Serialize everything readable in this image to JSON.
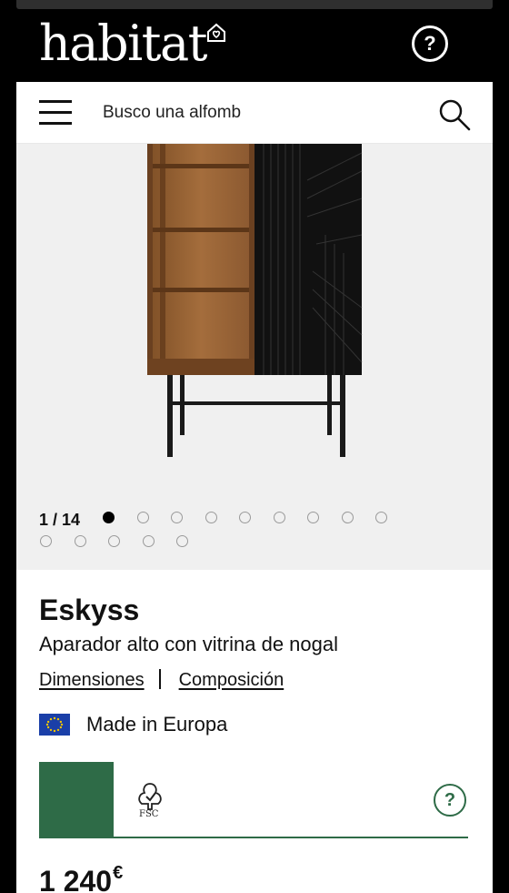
{
  "header": {
    "logo_text": "habitat",
    "help_label": "?"
  },
  "search": {
    "value": "Busco una alfomb"
  },
  "gallery": {
    "counter": "1 / 14",
    "total_images": 14,
    "current_image": 1
  },
  "product": {
    "name": "Eskyss",
    "description": "Aparador alto con vitrina de nogal",
    "link_dimensions": "Dimensiones",
    "link_composition": "Composición",
    "origin": "Made in Europa",
    "fsc_label": "FSC",
    "fsc_help": "?",
    "price": "1 240",
    "currency": "€"
  },
  "colors": {
    "header_bg": "#000000",
    "fsc_green": "#2e6b47",
    "eu_blue": "#1a3fa8",
    "walnut": "#9a6434",
    "gallery_bg": "#f0f0f0"
  },
  "icons": [
    "menu-icon",
    "search-icon",
    "help-icon",
    "eu-flag-icon",
    "fsc-tree-icon",
    "habitat-house-icon"
  ]
}
